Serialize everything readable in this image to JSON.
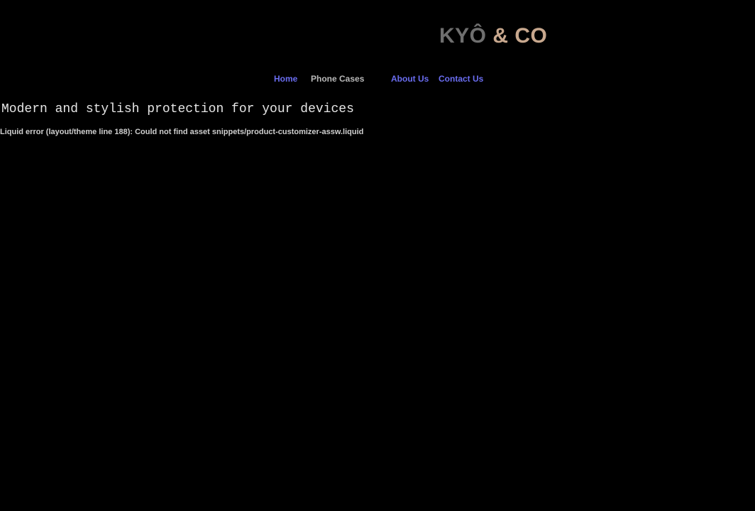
{
  "header": {
    "logo": {
      "part_a": "KYÔ",
      "part_b": "& CO",
      "color_a": "#6f6f6f",
      "color_b": "#c8a88e"
    }
  },
  "nav": {
    "items": [
      {
        "label": "Home",
        "color": "#6a6df0"
      },
      {
        "label": "Phone Cases",
        "color": "#b9b9b9"
      },
      {
        "label": "About Us",
        "color": "#6a6df0"
      },
      {
        "label": "Contact Us",
        "color": "#6a6df0"
      }
    ]
  },
  "main": {
    "headline": "Modern and stylish protection for your devices",
    "error_message": "Liquid error (layout/theme line 188): Could not find asset snippets/product-customizer-assw.liquid"
  },
  "colors": {
    "background": "#000000"
  }
}
